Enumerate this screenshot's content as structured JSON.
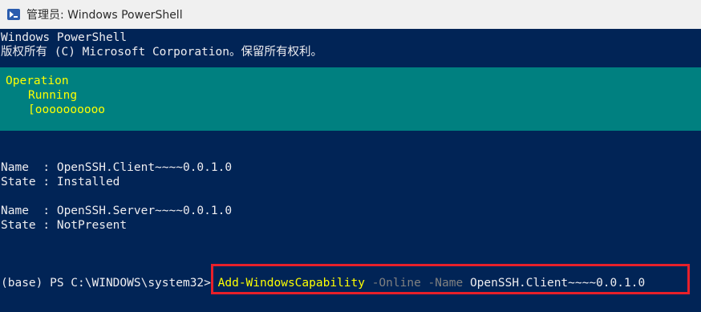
{
  "window": {
    "title": "管理员: Windows PowerShell",
    "icon": "powershell-icon"
  },
  "console": {
    "header_line1": "Windows PowerShell",
    "header_line2": "版权所有 (C) Microsoft Corporation。保留所有权利。",
    "progress": {
      "activity": "Operation",
      "status": "Running",
      "bar": "[oooooooooo"
    },
    "results": [
      {
        "name_line": "Name  : OpenSSH.Client~~~~0.0.1.0",
        "state_line": "State : Installed"
      },
      {
        "name_line": "Name  : OpenSSH.Server~~~~0.0.1.0",
        "state_line": "State : NotPresent"
      }
    ],
    "prompt": "(base) PS C:\\WINDOWS\\system32>",
    "command": {
      "cmdlet": "Add-WindowsCapability",
      "param_online": "-Online",
      "param_name": "-Name",
      "value": "OpenSSH.Client~~~~0.0.1.0"
    }
  },
  "colors": {
    "background": "#012456",
    "progress_background": "#008080",
    "progress_text": "#ffff00",
    "highlight_border": "#e8202a"
  }
}
